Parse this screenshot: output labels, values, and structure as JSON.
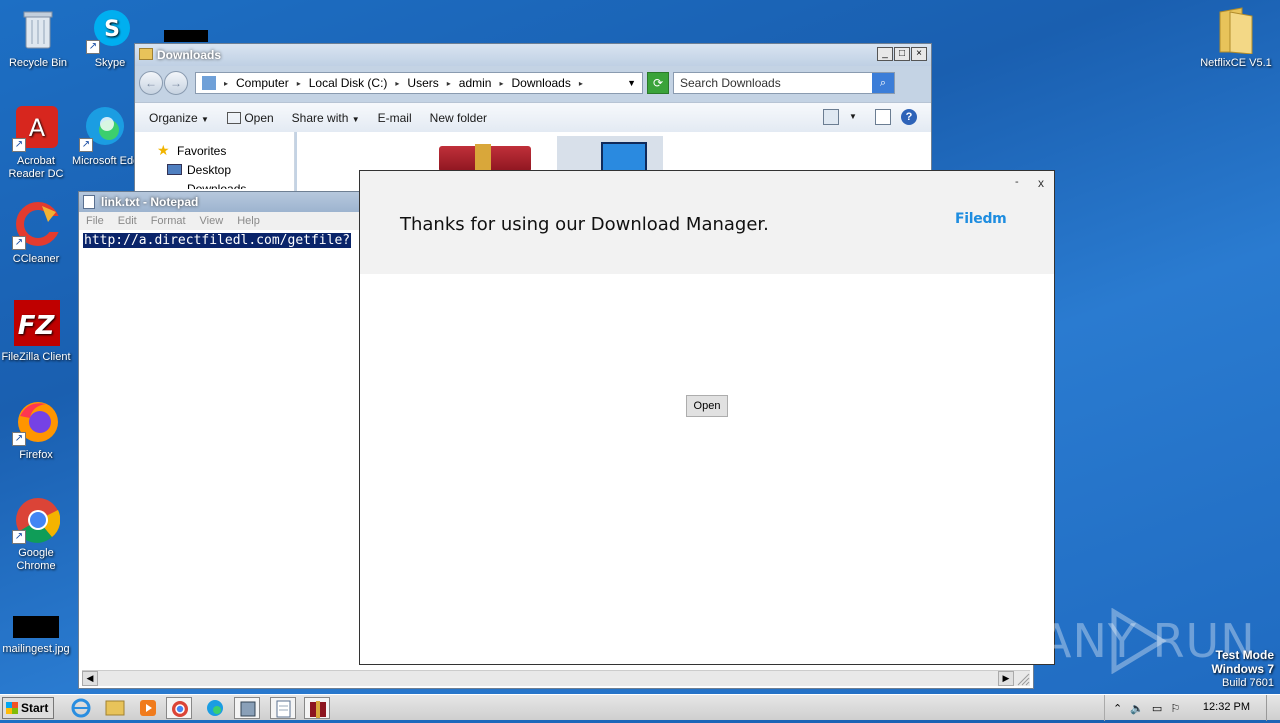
{
  "desktop": {
    "icons": [
      {
        "label": "Recycle Bin"
      },
      {
        "label": "Skype"
      },
      {
        "label": "Acrobat Reader DC"
      },
      {
        "label": "Microsoft Edge"
      },
      {
        "label": "CCleaner"
      },
      {
        "label": "FileZilla Client"
      },
      {
        "label": "Firefox"
      },
      {
        "label": "Google Chrome"
      },
      {
        "label": "mailingest.jpg"
      },
      {
        "label": "NetflixCE V5.1"
      }
    ]
  },
  "explorer": {
    "title": "Downloads",
    "breadcrumb": [
      "Computer",
      "Local Disk (C:)",
      "Users",
      "admin",
      "Downloads"
    ],
    "search_placeholder": "Search Downloads",
    "toolbar": {
      "organize": "Organize",
      "open": "Open",
      "share_with": "Share with",
      "email": "E-mail",
      "new_folder": "New folder"
    },
    "nav": {
      "favorites": "Favorites",
      "desktop": "Desktop",
      "downloads": "Downloads"
    }
  },
  "notepad": {
    "title": "link.txt - Notepad",
    "menu": [
      "File",
      "Edit",
      "Format",
      "View",
      "Help"
    ],
    "text": "http://a.directfiledl.com/getfile?"
  },
  "dialog": {
    "message": "Thanks for using our Download Manager.",
    "brand": "Filedm",
    "minimize": "-",
    "close": "x",
    "open_button": "Open"
  },
  "watermark": "ANY RUN",
  "test_mode": {
    "line1": "Test Mode",
    "line2": "Windows 7",
    "line3": "Build 7601"
  },
  "taskbar": {
    "start": "Start",
    "clock": "12:32 PM"
  }
}
